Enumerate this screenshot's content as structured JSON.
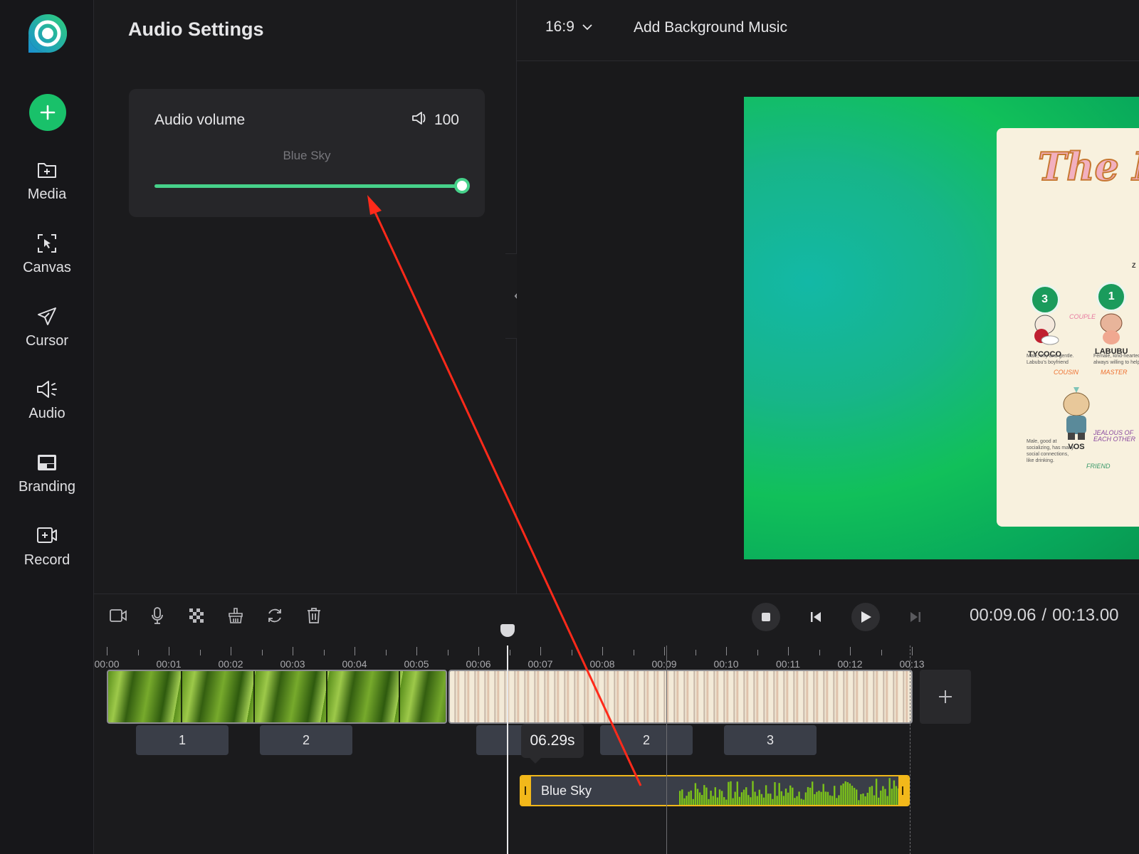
{
  "sidebar": {
    "items": [
      {
        "id": "media",
        "label": "Media",
        "icon": "folder-plus-icon"
      },
      {
        "id": "canvas",
        "label": "Canvas",
        "icon": "canvas-select-icon"
      },
      {
        "id": "cursor",
        "label": "Cursor",
        "icon": "cursor-arrow-icon"
      },
      {
        "id": "audio",
        "label": "Audio",
        "icon": "speaker-icon"
      },
      {
        "id": "branding",
        "label": "Branding",
        "icon": "branding-icon"
      },
      {
        "id": "record",
        "label": "Record",
        "icon": "record-icon"
      }
    ]
  },
  "settings": {
    "title": "Audio Settings",
    "volume_label": "Audio volume",
    "volume_value": "100",
    "volume_fraction": 1.0,
    "track_name": "Blue Sky"
  },
  "topbar": {
    "aspect_ratio": "16:9",
    "background_music": "Add Background Music"
  },
  "preview": {
    "poster_title": "The M",
    "characters": [
      {
        "number": "3",
        "name": "TYCOCO",
        "note": "Male, shy and gentle. Labubu's boyfriend"
      },
      {
        "number": "1",
        "name": "LABUBU",
        "note": "Female, kind-hearted, always willing to help"
      },
      {
        "number": "",
        "name": "VOS",
        "note": "Male, good at socializing, has many social connections, like drinking."
      }
    ],
    "relations": [
      "COUPLE",
      "COUSIN",
      "MASTER",
      "JEALOUS OF EACH OTHER",
      "FRIEND"
    ],
    "partial_label": "Z"
  },
  "timeline": {
    "current_time": "00:09.06",
    "separator": "/",
    "total_time": "00:13.00",
    "ruler_labels": [
      "00:00",
      "00:01",
      "00:02",
      "00:03",
      "00:04",
      "00:05",
      "00:06",
      "00:07",
      "00:08",
      "00:09",
      "00:10",
      "00:11",
      "00:12",
      "00:13"
    ],
    "markers": [
      "1",
      "2",
      "",
      "2",
      "3"
    ],
    "tooltip": "06.29s",
    "audio_clip_name": "Blue Sky"
  },
  "colors": {
    "accent_green": "#19c16a",
    "slider_green": "#46d18a",
    "audio_border": "#f2b81a",
    "annotation_arrow": "#ff2a1a"
  }
}
